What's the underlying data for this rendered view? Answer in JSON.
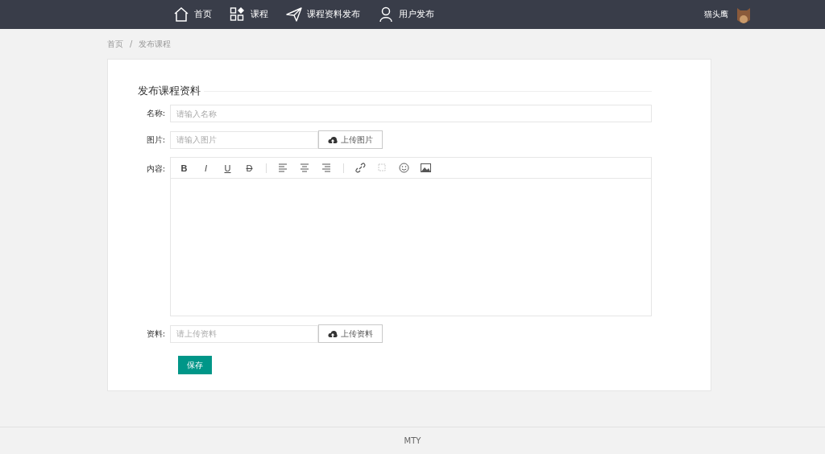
{
  "nav": {
    "items": [
      {
        "label": "首页"
      },
      {
        "label": "课程"
      },
      {
        "label": "课程资料发布"
      },
      {
        "label": "用户发布"
      }
    ],
    "user": {
      "name": "猫头鹰"
    }
  },
  "breadcrumb": {
    "items": [
      "首页",
      "发布课程"
    ],
    "separator": "/"
  },
  "form": {
    "title": "发布课程资料",
    "fields": [
      {
        "kind": "text",
        "label": "名称:",
        "placeholder": "请输入名称"
      },
      {
        "kind": "upload",
        "label": "图片:",
        "placeholder": "请输入图片",
        "button": "上传图片"
      },
      {
        "kind": "editor",
        "label": "内容:",
        "tools": [
          {
            "kind": "glyph",
            "label": "B",
            "disabled": false
          },
          {
            "kind": "glyph",
            "label": "I",
            "disabled": false
          },
          {
            "kind": "glyph",
            "label": "U",
            "disabled": false
          },
          {
            "kind": "glyph",
            "label": "D",
            "disabled": false
          },
          {
            "kind": "divider"
          },
          {
            "kind": "icon",
            "disabled": false
          },
          {
            "kind": "icon",
            "disabled": false
          },
          {
            "kind": "icon",
            "disabled": false
          },
          {
            "kind": "divider"
          },
          {
            "kind": "icon",
            "disabled": false
          },
          {
            "kind": "icon",
            "disabled": true
          },
          {
            "kind": "icon",
            "disabled": false
          },
          {
            "kind": "icon",
            "disabled": false
          }
        ]
      },
      {
        "kind": "upload",
        "label": "资料:",
        "placeholder": "请上传资料",
        "button": "上传资料"
      }
    ],
    "submit": "保存"
  },
  "footer": "MTY"
}
